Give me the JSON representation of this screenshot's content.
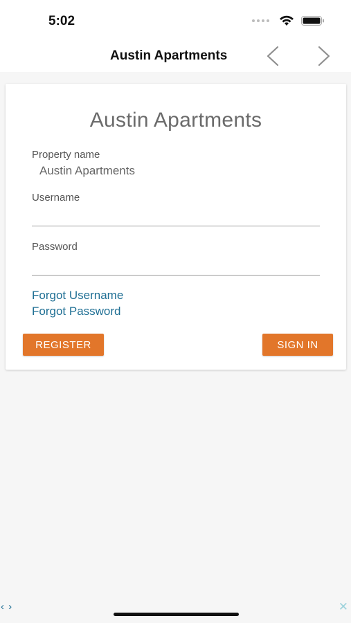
{
  "status_bar": {
    "time": "5:02"
  },
  "nav": {
    "title": "Austin Apartments"
  },
  "card": {
    "title": "Austin Apartments",
    "property_label": "Property name",
    "property_value": "Austin Apartments",
    "username_label": "Username",
    "username_value": "",
    "password_label": "Password",
    "password_value": "",
    "forgot_username": "Forgot Username",
    "forgot_password": "Forgot Password",
    "register_label": "REGISTER",
    "signin_label": "SIGN IN"
  },
  "footer": {
    "arrows": "‹ ›",
    "close": "✕"
  },
  "colors": {
    "accent_button": "#e2762a",
    "link": "#1f6f94",
    "background": "#f6f6f6"
  },
  "icons": [
    "wifi-icon",
    "battery-icon",
    "back-chevron-icon",
    "forward-chevron-icon"
  ]
}
